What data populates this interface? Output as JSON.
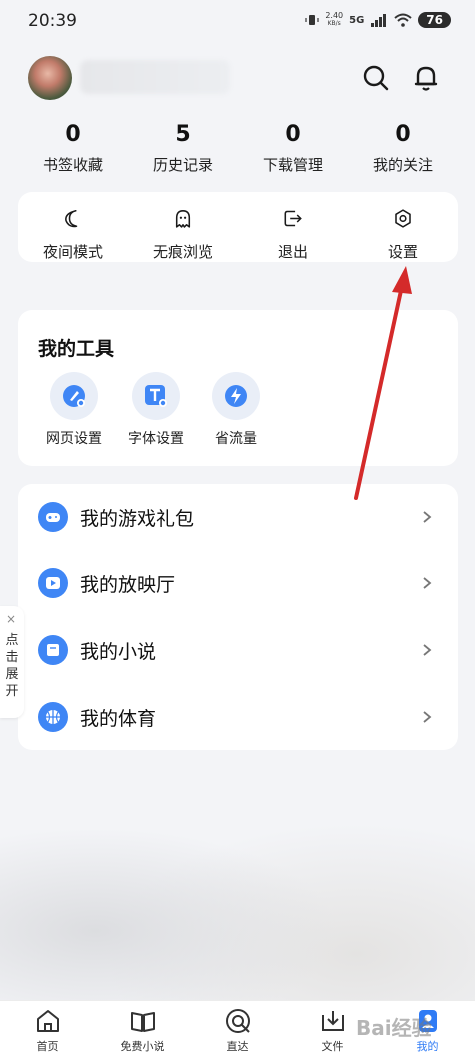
{
  "status_bar": {
    "time": "20:39",
    "speed_value": "2.40",
    "speed_unit": "KB/s",
    "network": "5G",
    "battery": "76"
  },
  "header": {
    "avatar": "user-avatar",
    "search_icon": "search-icon",
    "bell_icon": "bell-icon"
  },
  "stats": [
    {
      "value": "0",
      "label": "书签收藏"
    },
    {
      "value": "5",
      "label": "历史记录"
    },
    {
      "value": "0",
      "label": "下载管理"
    },
    {
      "value": "0",
      "label": "我的关注"
    }
  ],
  "quick_actions": [
    {
      "label": "夜间模式",
      "icon": "moon-icon"
    },
    {
      "label": "无痕浏览",
      "icon": "ghost-icon"
    },
    {
      "label": "退出",
      "icon": "logout-icon"
    },
    {
      "label": "设置",
      "icon": "gear-icon"
    }
  ],
  "tools": {
    "title": "我的工具",
    "items": [
      {
        "label": "网页设置",
        "icon": "web-settings-icon"
      },
      {
        "label": "字体设置",
        "icon": "font-settings-icon"
      },
      {
        "label": "省流量",
        "icon": "data-saver-icon"
      }
    ]
  },
  "list": [
    {
      "label": "我的游戏礼包",
      "icon": "game-gift-icon"
    },
    {
      "label": "我的放映厅",
      "icon": "play-icon"
    },
    {
      "label": "我的小说",
      "icon": "book-icon"
    },
    {
      "label": "我的体育",
      "icon": "basketball-icon"
    }
  ],
  "side_tab": {
    "close": "×",
    "text": "点击展开"
  },
  "bottom_nav": [
    {
      "label": "首页",
      "icon": "home-icon"
    },
    {
      "label": "免费小说",
      "icon": "open-book-icon"
    },
    {
      "label": "直达",
      "icon": "direct-icon"
    },
    {
      "label": "文件",
      "icon": "download-folder-icon"
    },
    {
      "label": "我的",
      "icon": "profile-icon",
      "active": true
    }
  ],
  "watermark": "Bai经验",
  "colors": {
    "accent": "#2f7bf5",
    "list_icon": "#3f86f5",
    "arrow": "#d42a2a"
  }
}
